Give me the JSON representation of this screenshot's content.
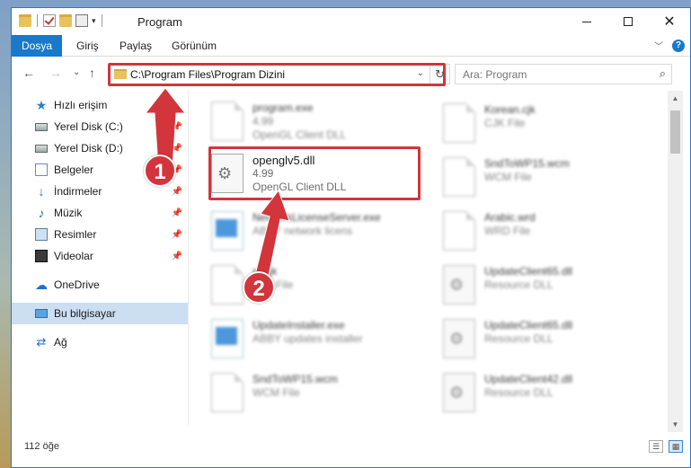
{
  "window": {
    "title": "Program"
  },
  "ribbon": {
    "tabs": [
      "Dosya",
      "Giriş",
      "Paylaş",
      "Görünüm"
    ]
  },
  "nav": {
    "back": "←",
    "forward": "→",
    "recent": "⌄",
    "up": "↑",
    "address": "C:\\Program Files\\Program Dizini",
    "refresh": "↻",
    "search_placeholder": "Ara: Program"
  },
  "sidebar": {
    "items": [
      {
        "label": "Hızlı erişim",
        "icon": "star-icon",
        "pinned": false
      },
      {
        "label": "Yerel Disk (C:)",
        "icon": "disk-icon",
        "pinned": true
      },
      {
        "label": "Yerel Disk (D:)",
        "icon": "disk-icon",
        "pinned": true
      },
      {
        "label": "Belgeler",
        "icon": "documents-icon",
        "pinned": true
      },
      {
        "label": "İndirmeler",
        "icon": "download-icon",
        "pinned": true
      },
      {
        "label": "Müzik",
        "icon": "music-icon",
        "pinned": true
      },
      {
        "label": "Resimler",
        "icon": "pictures-icon",
        "pinned": true
      },
      {
        "label": "Videolar",
        "icon": "videos-icon",
        "pinned": true
      },
      {
        "label": "OneDrive",
        "icon": "cloud-icon",
        "pinned": false
      },
      {
        "label": "Bu bilgisayar",
        "icon": "computer-icon",
        "pinned": false
      },
      {
        "label": "Ağ",
        "icon": "network-icon",
        "pinned": false
      }
    ],
    "pin_glyph": "📌"
  },
  "files": {
    "col1": [
      {
        "name": "program.exe",
        "meta1": "4.99",
        "meta2": "OpenGL Client DLL"
      },
      {
        "name": "openglv5.dll",
        "meta1": "4.99",
        "meta2": "OpenGL Client DLL"
      },
      {
        "name": "NetworkLicenseServer.exe",
        "meta1": "ABBY network licens",
        "meta2": ""
      },
      {
        "name": "sr.cjk",
        "meta1": "CJK File",
        "meta2": ""
      },
      {
        "name": "UpdateInstaller.exe",
        "meta1": "ABBY updates installer",
        "meta2": ""
      },
      {
        "name": "SndToWP15.wcm",
        "meta1": "WCM File",
        "meta2": ""
      }
    ],
    "col2": [
      {
        "name": "Korean.cjk",
        "meta1": "CJK File"
      },
      {
        "name": "SndToWP15.wcm",
        "meta1": "WCM File"
      },
      {
        "name": "Arabic.wrd",
        "meta1": "WRD File"
      },
      {
        "name": "UpdateClient65.dll",
        "meta1": "Resource DLL"
      },
      {
        "name": "UpdateClient65.dll",
        "meta1": "Resource DLL"
      },
      {
        "name": "UpdateClient42.dll",
        "meta1": "Resource DLL"
      }
    ]
  },
  "status": {
    "count": "112 öğe"
  },
  "annotations": {
    "step1": "1",
    "step2": "2",
    "highlight_color": "#d2353b"
  }
}
